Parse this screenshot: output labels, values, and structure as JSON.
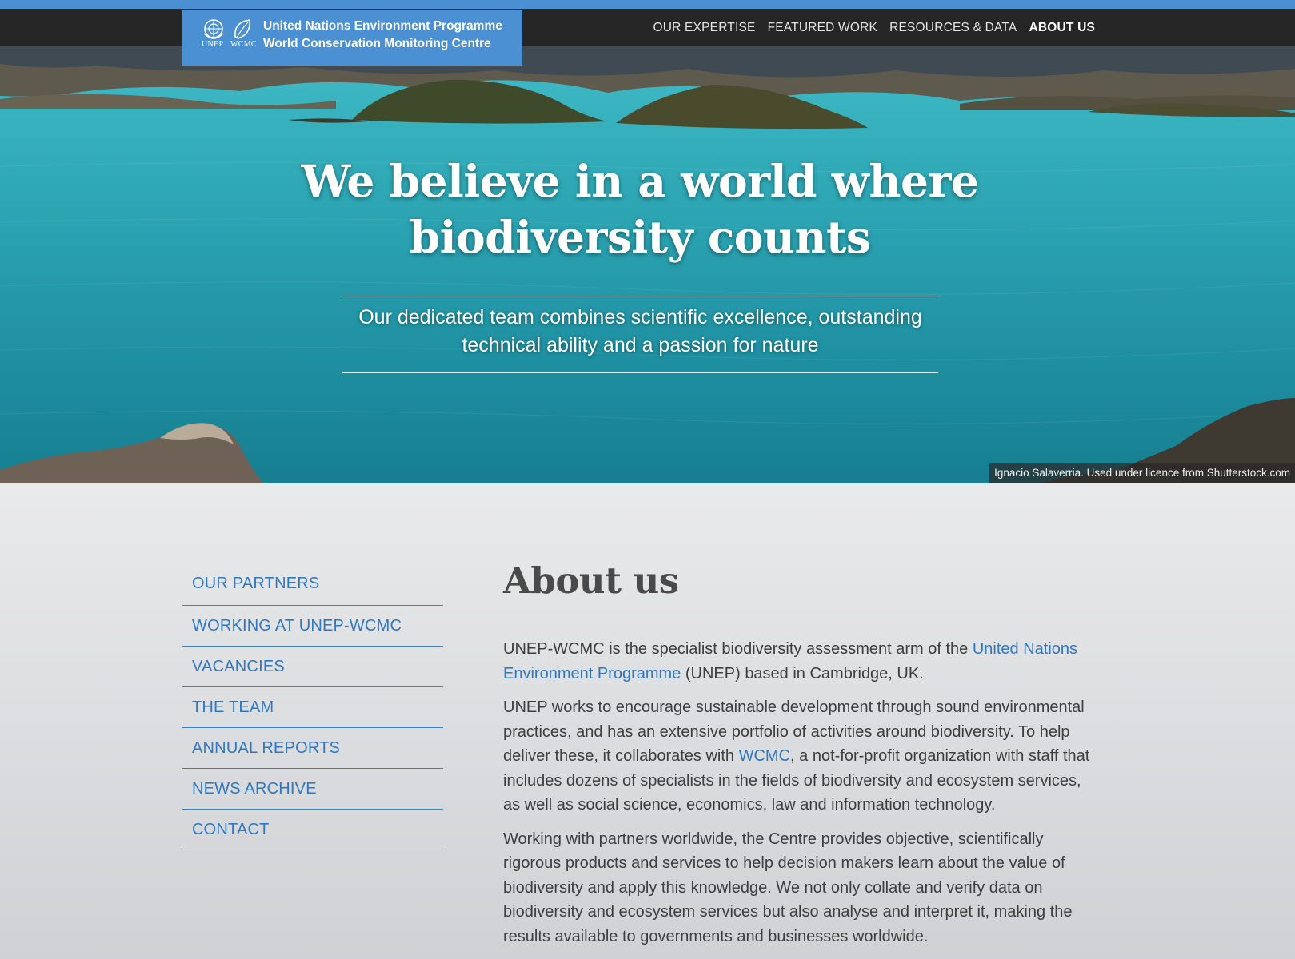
{
  "brand": {
    "line1": "United Nations Environment Programme",
    "line2": "World Conservation Monitoring Centre",
    "abbr_unep": "UNEP",
    "abbr_wcmc": "WCMC",
    "color": "#4a90d2"
  },
  "nav": {
    "items": [
      {
        "label": "OUR EXPERTISE"
      },
      {
        "label": "FEATURED WORK"
      },
      {
        "label": "RESOURCES & DATA"
      },
      {
        "label": "ABOUT US",
        "active": true
      }
    ]
  },
  "hero": {
    "title_line1": "We believe in a world where",
    "title_line2": "biodiversity counts",
    "subtitle_line1": "Our dedicated team combines scientific excellence, outstanding",
    "subtitle_line2": "technical ability and a passion for nature",
    "credit": "Ignacio Salaverria. Used under licence from Shutterstock.com"
  },
  "sidebar": {
    "items": [
      {
        "label": "OUR PARTNERS"
      },
      {
        "label": "WORKING AT UNEP-WCMC"
      },
      {
        "label": "VACANCIES"
      },
      {
        "label": "THE TEAM"
      },
      {
        "label": "ANNUAL REPORTS"
      },
      {
        "label": "NEWS ARCHIVE"
      },
      {
        "label": "CONTACT"
      }
    ]
  },
  "about": {
    "title": "About us",
    "p1_pre": "UNEP-WCMC is the specialist biodiversity assessment arm of the ",
    "p1_link": "United Nations Environment Programme",
    "p1_post": " (UNEP) based in Cambridge, UK.",
    "p2_pre": "UNEP works to encourage sustainable development through sound environmental practices, and has an extensive portfolio of activities around biodiversity. To help deliver these, it collaborates with ",
    "p2_link": "WCMC",
    "p2_post": ", a not-for-profit organization with staff that includes dozens of specialists in the fields of biodiversity and ecosystem services, as well as social science, economics, law and information technology.",
    "p3": "Working with partners worldwide, the Centre provides objective, scientifically rigorous products and services to help decision makers learn about the value of biodiversity and apply this knowledge. We not only collate and verify data on biodiversity and ecosystem services but also analyse and interpret it, making the results available to governments and businesses worldwide."
  },
  "colors": {
    "link": "#2f78c1",
    "navbar": "#262626",
    "accent": "#4a90d2"
  }
}
